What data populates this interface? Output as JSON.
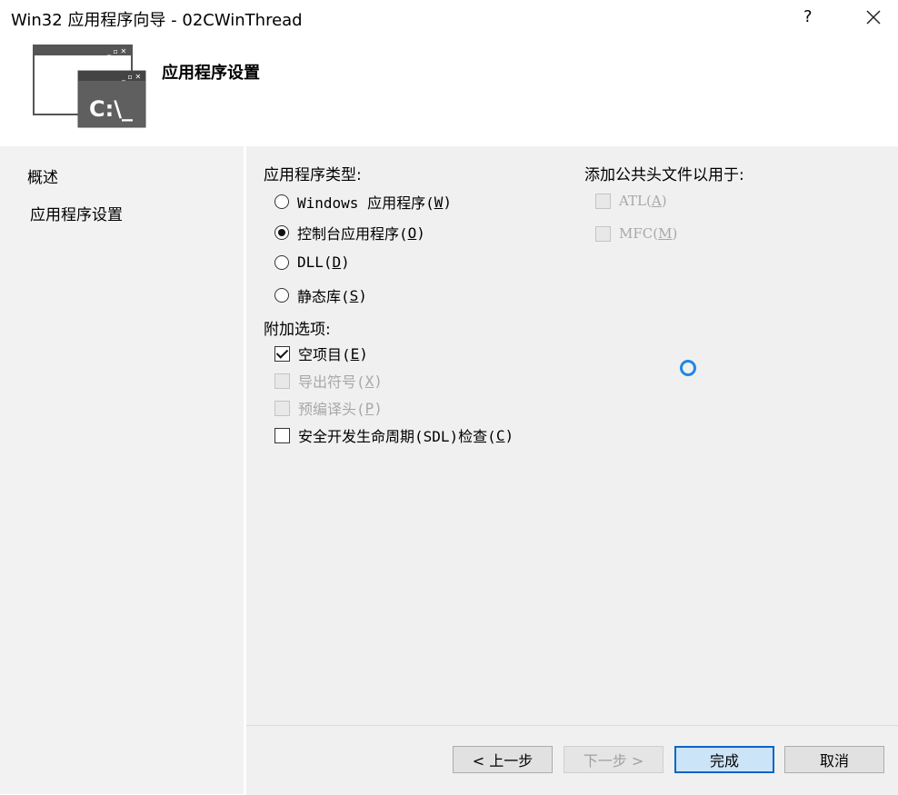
{
  "window": {
    "title": "Win32 应用程序向导 - 02CWinThread",
    "help": "?"
  },
  "header": {
    "title": "应用程序设置",
    "logo_text": "C:\\_"
  },
  "nav": {
    "items": [
      {
        "label": "概述"
      },
      {
        "label": "应用程序设置"
      }
    ]
  },
  "app_type": {
    "label": "应用程序类型:",
    "options": [
      {
        "text": "Windows 应用程序(",
        "key": "W",
        "tail": ")",
        "checked": false
      },
      {
        "text": "控制台应用程序(",
        "key": "O",
        "tail": ")",
        "checked": true
      },
      {
        "text": "DLL(",
        "key": "D",
        "tail": ")",
        "checked": false
      },
      {
        "text": "静态库(",
        "key": "S",
        "tail": ")",
        "checked": false
      }
    ]
  },
  "extra": {
    "label": "附加选项:",
    "options": [
      {
        "text": "空项目(",
        "key": "E",
        "tail": ")",
        "checked": true,
        "enabled": true
      },
      {
        "text": "导出符号(",
        "key": "X",
        "tail": ")",
        "checked": false,
        "enabled": false
      },
      {
        "text": "预编译头(",
        "key": "P",
        "tail": ")",
        "checked": false,
        "enabled": false
      },
      {
        "text": "安全开发生命周期(SDL)检查(",
        "key": "C",
        "tail": ")",
        "checked": false,
        "enabled": true
      }
    ]
  },
  "headers": {
    "label": "添加公共头文件以用于:",
    "options": [
      {
        "text": "ATL(",
        "key": "A",
        "tail": ")",
        "checked": false,
        "enabled": false
      },
      {
        "text": "MFC(",
        "key": "M",
        "tail": ")",
        "checked": false,
        "enabled": false
      }
    ]
  },
  "buttons": {
    "prev": "< 上一步",
    "next": "下一步 >",
    "finish": "完成",
    "cancel": "取消"
  },
  "colors": {
    "accent": "#0a64c8",
    "spinner": "#1e88e5"
  }
}
